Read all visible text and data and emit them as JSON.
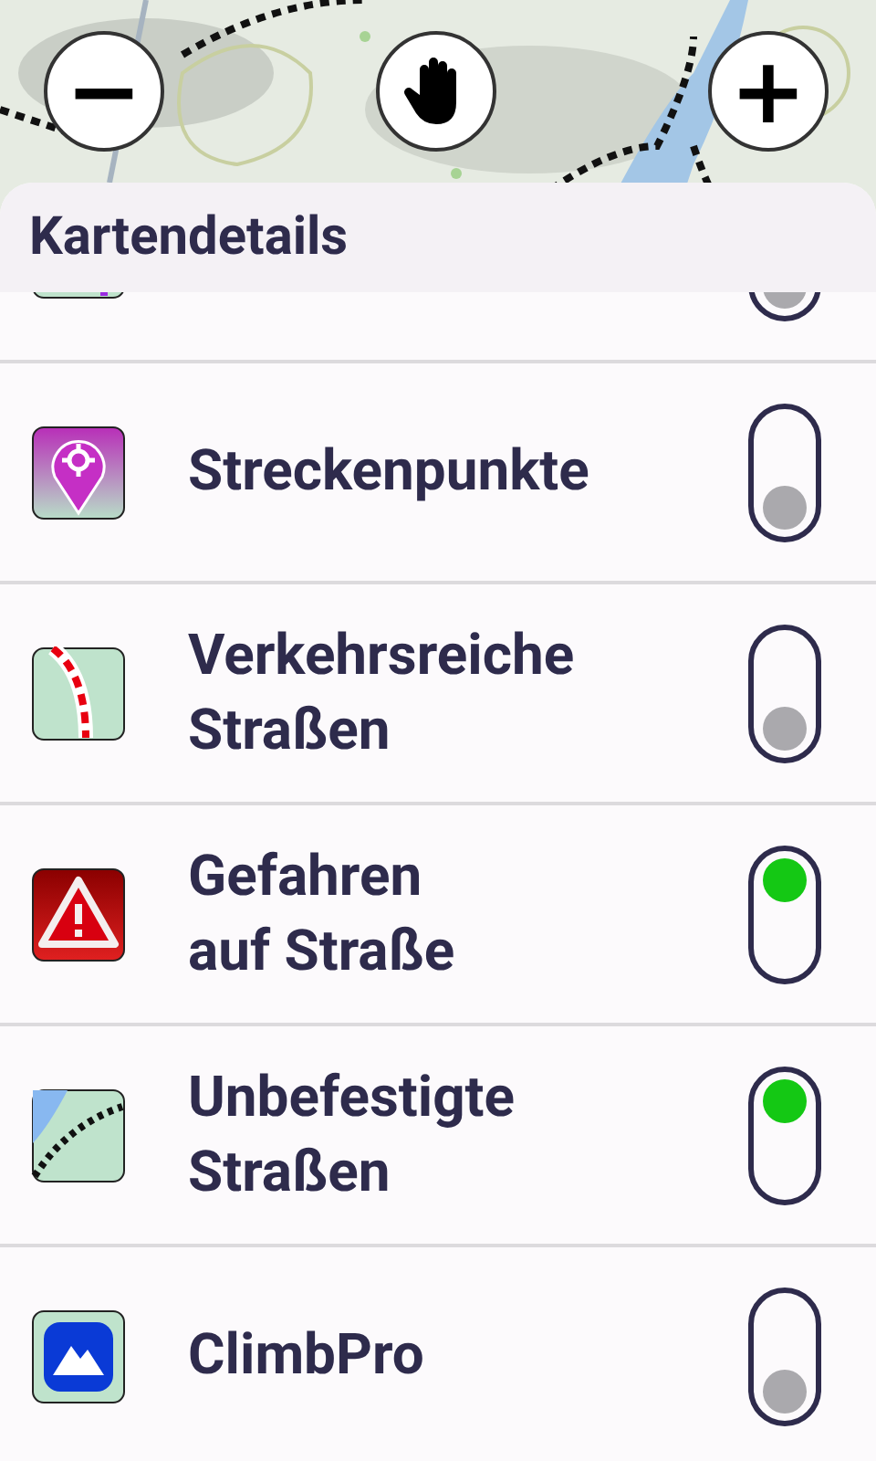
{
  "map": {
    "zoom_out": "−",
    "zoom_in": "+"
  },
  "panel": {
    "title": "Kartendetails"
  },
  "items": [
    {
      "kind": "route",
      "on": false
    },
    {
      "kind": "waypoint",
      "label": "Streckenpunkte",
      "on": false
    },
    {
      "kind": "traffic",
      "label": "Verkehrsreiche Straßen",
      "on": false
    },
    {
      "kind": "hazard",
      "label": "Gefahren auf Straße",
      "on": true
    },
    {
      "kind": "unpaved",
      "label": "Unbefestigte Straßen",
      "on": true
    },
    {
      "kind": "climb",
      "label": "ClimbPro",
      "on": false
    }
  ]
}
